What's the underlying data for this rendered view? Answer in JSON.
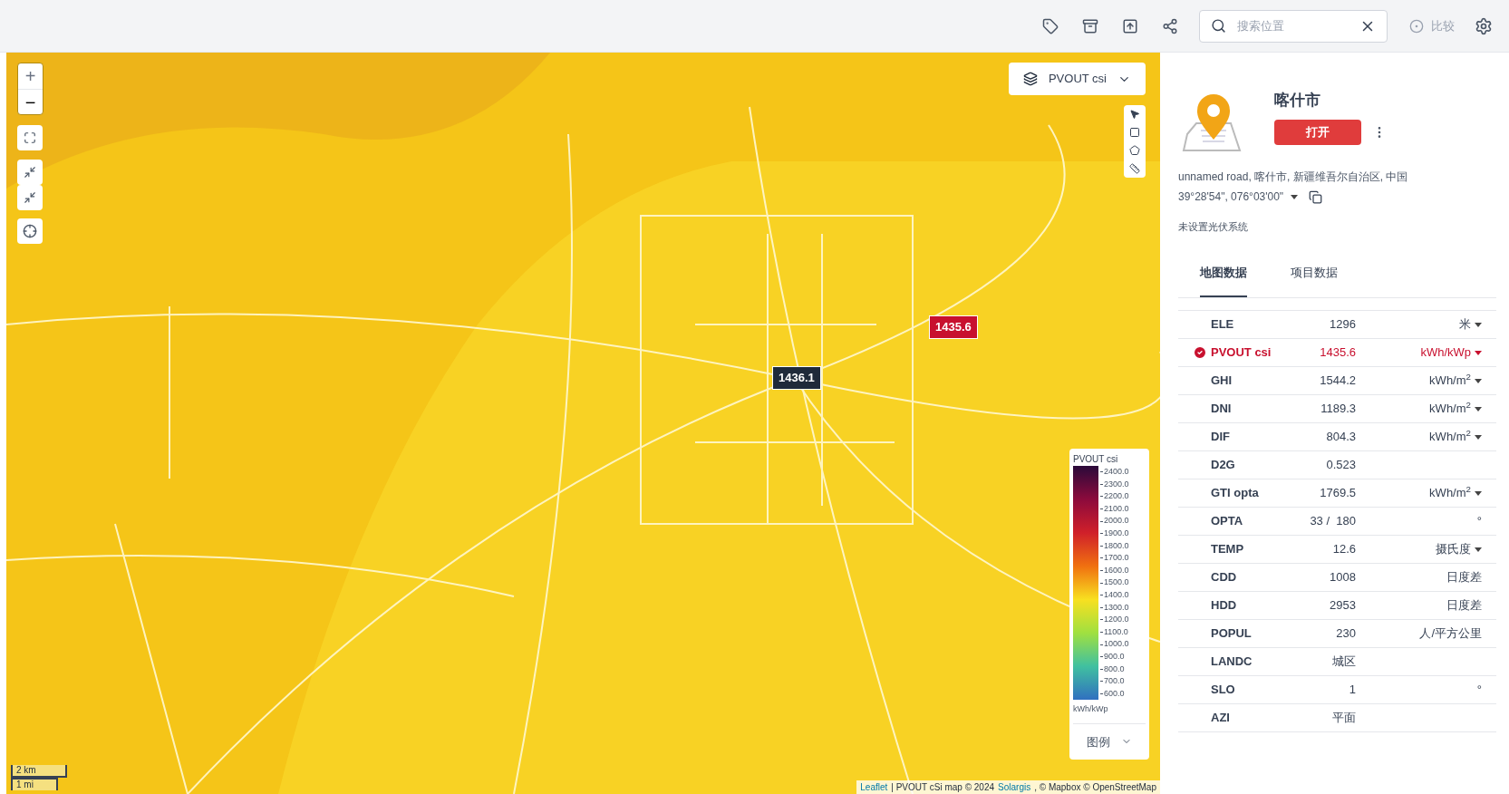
{
  "toolbar": {
    "search": {
      "placeholder": "搜索位置"
    },
    "compare": {
      "label": "比较",
      "disabled": true
    }
  },
  "map": {
    "layer_select": {
      "label": "PVOUT csi"
    },
    "zoom_in": {
      "label": "+",
      "disabled": true
    },
    "zoom_out": {
      "label": "−",
      "disabled": false
    },
    "markers": [
      {
        "label": "1436.1",
        "selected": false
      },
      {
        "label": "1435.6",
        "selected": true
      }
    ],
    "legend": {
      "title": "PVOUT csi",
      "ticks": [
        "2400.0",
        "2300.0",
        "2200.0",
        "2100.0",
        "2000.0",
        "1900.0",
        "1800.0",
        "1700.0",
        "1600.0",
        "1500.0",
        "1400.0",
        "1300.0",
        "1200.0",
        "1100.0",
        "1000.0",
        "900.0",
        "800.0",
        "700.0",
        "600.0"
      ],
      "unit": "kWh/kWp",
      "toggle": "图例",
      "expanded": false
    },
    "scale": [
      "2 km",
      "1 mi"
    ],
    "attribution": [
      {
        "kind": "link",
        "text": "Leaflet"
      },
      {
        "kind": "text",
        "text": "| PVOUT cSi map © 2024"
      },
      {
        "kind": "link",
        "text": "Solargis"
      },
      {
        "kind": "text",
        "text": ", © Mapbox © OpenStreetMap"
      }
    ]
  },
  "panel": {
    "title": "喀什市",
    "open_button": "打开",
    "address": "unnamed road, 喀什市, 新疆维吾尔自治区, 中国",
    "coords": "39°28'54\", 076°03'00\"",
    "status": "未设置光伏系统",
    "tabs": [
      {
        "label": "地图数据",
        "selected": true
      },
      {
        "label": "项目数据",
        "selected": false
      }
    ],
    "rows": [
      {
        "name": "ELE",
        "value": "1296",
        "unit": "米",
        "dropdown": true,
        "selected": false
      },
      {
        "name": "PVOUT csi",
        "value": "1435.6",
        "unit": "kWh/kWp",
        "dropdown": true,
        "selected": true
      },
      {
        "name": "GHI",
        "value": "1544.2",
        "unit": "kWh/m$^{2}$",
        "dropdown": true,
        "selected": false
      },
      {
        "name": "DNI",
        "value": "1189.3",
        "unit": "kWh/m$^{2}$",
        "dropdown": true,
        "selected": false
      },
      {
        "name": "DIF",
        "value": "804.3",
        "unit": "kWh/m$^{2}$",
        "dropdown": true,
        "selected": false
      },
      {
        "name": "D2G",
        "value": "0.523",
        "dropdown": false,
        "selected": false
      },
      {
        "name": "GTI opta",
        "value": "1769.5",
        "unit": "kWh/m$^{2}$",
        "dropdown": true,
        "selected": false
      },
      {
        "name": "OPTA",
        "value": "33 /  180",
        "unit": "°",
        "dropdown": false,
        "selected": false
      },
      {
        "name": "TEMP",
        "value": "12.6",
        "unit": "摄氏度",
        "dropdown": true,
        "selected": false
      },
      {
        "name": "CDD",
        "value": "1008",
        "unit": "日度差",
        "dropdown": false,
        "selected": false
      },
      {
        "name": "HDD",
        "value": "2953",
        "unit": "日度差",
        "dropdown": false,
        "selected": false
      },
      {
        "name": "POPUL",
        "value": "230",
        "unit": "人/平方公里",
        "dropdown": false,
        "selected": false
      },
      {
        "name": "LANDC",
        "value": "城区",
        "dropdown": false,
        "selected": false
      },
      {
        "name": "SLO",
        "value": "1",
        "unit": "°",
        "dropdown": false,
        "selected": false
      },
      {
        "name": "AZI",
        "value": "平面",
        "dropdown": false,
        "selected": false
      }
    ]
  }
}
